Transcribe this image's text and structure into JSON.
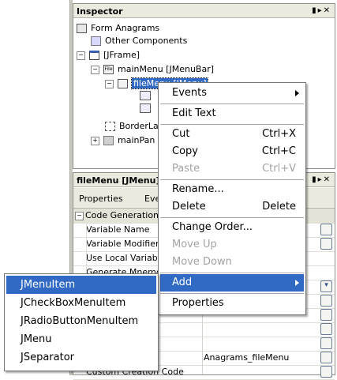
{
  "inspector": {
    "title": "Inspector",
    "window_buttons": "▮▸✕",
    "tree": [
      {
        "label": "Form Anagrams"
      },
      {
        "label": "Other Components"
      },
      {
        "label": "[JFrame]"
      },
      {
        "label": "mainMenu [JMenuBar]"
      },
      {
        "label": "fileMenu [JMenu]"
      },
      {
        "label": "BorderLa"
      },
      {
        "label": "mainPan"
      }
    ]
  },
  "properties": {
    "title": "fileMenu [JMenu]",
    "window_buttons": "▮▸✕",
    "tabs": [
      "Properties",
      "Eve"
    ],
    "category": "Code Generation",
    "rows": [
      {
        "name": "Variable Name",
        "value": ""
      },
      {
        "name": "Variable Modifiers",
        "value": ""
      },
      {
        "name": "Use Local Variable",
        "value": ""
      },
      {
        "name": "Generate Mnemon",
        "value": ""
      },
      {
        "name": "",
        "value": "Anagrams_fileMenu"
      },
      {
        "name": "Custom Creation Code",
        "value": ""
      }
    ]
  },
  "context_menu": {
    "items": [
      {
        "label": "Events",
        "accel": ""
      },
      {
        "label": "Edit Text",
        "accel": ""
      },
      {
        "label": "Cut",
        "accel": "Ctrl+X"
      },
      {
        "label": "Copy",
        "accel": "Ctrl+C"
      },
      {
        "label": "Paste",
        "accel": "Ctrl+V"
      },
      {
        "label": "Rename...",
        "accel": ""
      },
      {
        "label": "Delete",
        "accel": "Delete"
      },
      {
        "label": "Change Order...",
        "accel": ""
      },
      {
        "label": "Move Up",
        "accel": ""
      },
      {
        "label": "Move Down",
        "accel": ""
      },
      {
        "label": "Add",
        "accel": ""
      },
      {
        "label": "Properties",
        "accel": ""
      }
    ]
  },
  "add_submenu": {
    "items": [
      "JMenuItem",
      "JCheckBoxMenuItem",
      "JRadioButtonMenuItem",
      "JMenu",
      "JSeparator"
    ]
  },
  "colors": {
    "selection": "#316ac5",
    "panel_header": "#ebeade",
    "disabled_text": "#a3a3a3"
  }
}
